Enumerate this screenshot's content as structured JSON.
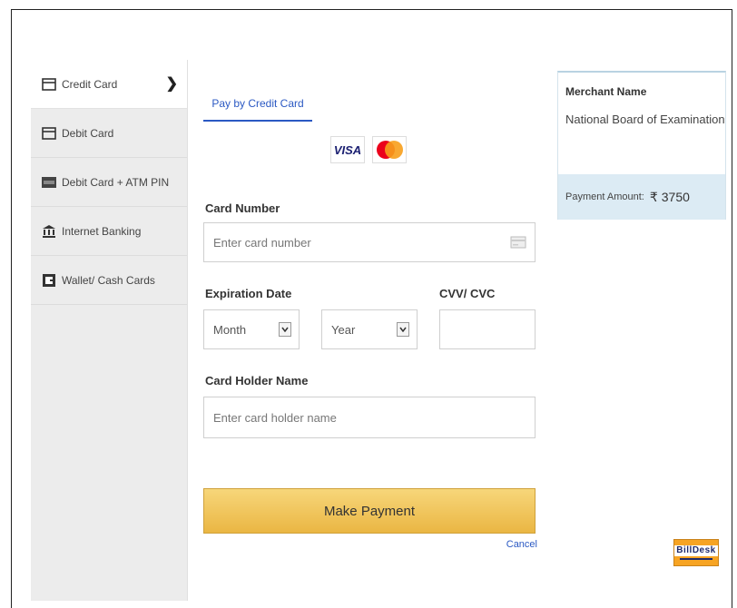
{
  "sidebar": {
    "items": [
      {
        "label": "Credit Card",
        "icon": "credit-card-icon",
        "active": true
      },
      {
        "label": "Debit Card",
        "icon": "debit-card-icon",
        "active": false
      },
      {
        "label": "Debit Card + ATM PIN",
        "icon": "atm-pin-icon",
        "active": false
      },
      {
        "label": "Internet Banking",
        "icon": "bank-icon",
        "active": false
      },
      {
        "label": "Wallet/ Cash Cards",
        "icon": "wallet-icon",
        "active": false
      }
    ]
  },
  "form": {
    "tab_label": "Pay by Credit Card",
    "card_logos": {
      "visa": "VISA",
      "mastercard": "mastercard-logo"
    },
    "card_number_label": "Card Number",
    "card_number_placeholder": "Enter card number",
    "expiry_label": "Expiration Date",
    "month_value": "Month",
    "year_value": "Year",
    "cvv_label": "CVV/ CVC",
    "holder_label": "Card Holder Name",
    "holder_placeholder": "Enter card holder name",
    "submit_label": "Make Payment",
    "cancel_label": "Cancel"
  },
  "merchant": {
    "title": "Merchant Name",
    "name": "National Board of Examination",
    "amount_label": "Payment Amount:",
    "currency": "₹",
    "amount": "3750"
  },
  "branding": {
    "billdesk_text": "BillDesk"
  },
  "colors": {
    "accent": "#2b59c3",
    "button": "#eab643",
    "sidebar": "#ececec",
    "amount_bg": "#dcebf4"
  }
}
